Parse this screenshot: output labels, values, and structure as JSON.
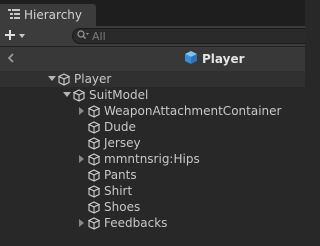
{
  "tab": {
    "title": "Hierarchy",
    "icon": "hierarchy-list-icon"
  },
  "toolbar": {
    "add_icon": "plus-icon",
    "dropdown_icon": "caret-down-icon",
    "search_placeholder": "All",
    "search_icon": "search-icon"
  },
  "prefab_header": {
    "back_icon": "chevron-left-icon",
    "title": "Player",
    "prefab_icon_color": "#4fa8e8"
  },
  "tree": {
    "root": {
      "label": "Player",
      "expanded": true
    },
    "child": {
      "label": "SuitModel",
      "expanded": true
    },
    "items": [
      {
        "label": "WeaponAttachmentContainer",
        "has_children": true
      },
      {
        "label": "Dude",
        "has_children": false
      },
      {
        "label": "Jersey",
        "has_children": false
      },
      {
        "label": "mmntnsrig:Hips",
        "has_children": true
      },
      {
        "label": "Pants",
        "has_children": false
      },
      {
        "label": "Shirt",
        "has_children": false
      },
      {
        "label": "Shoes",
        "has_children": false
      },
      {
        "label": "Feedbacks",
        "has_children": true
      }
    ]
  }
}
